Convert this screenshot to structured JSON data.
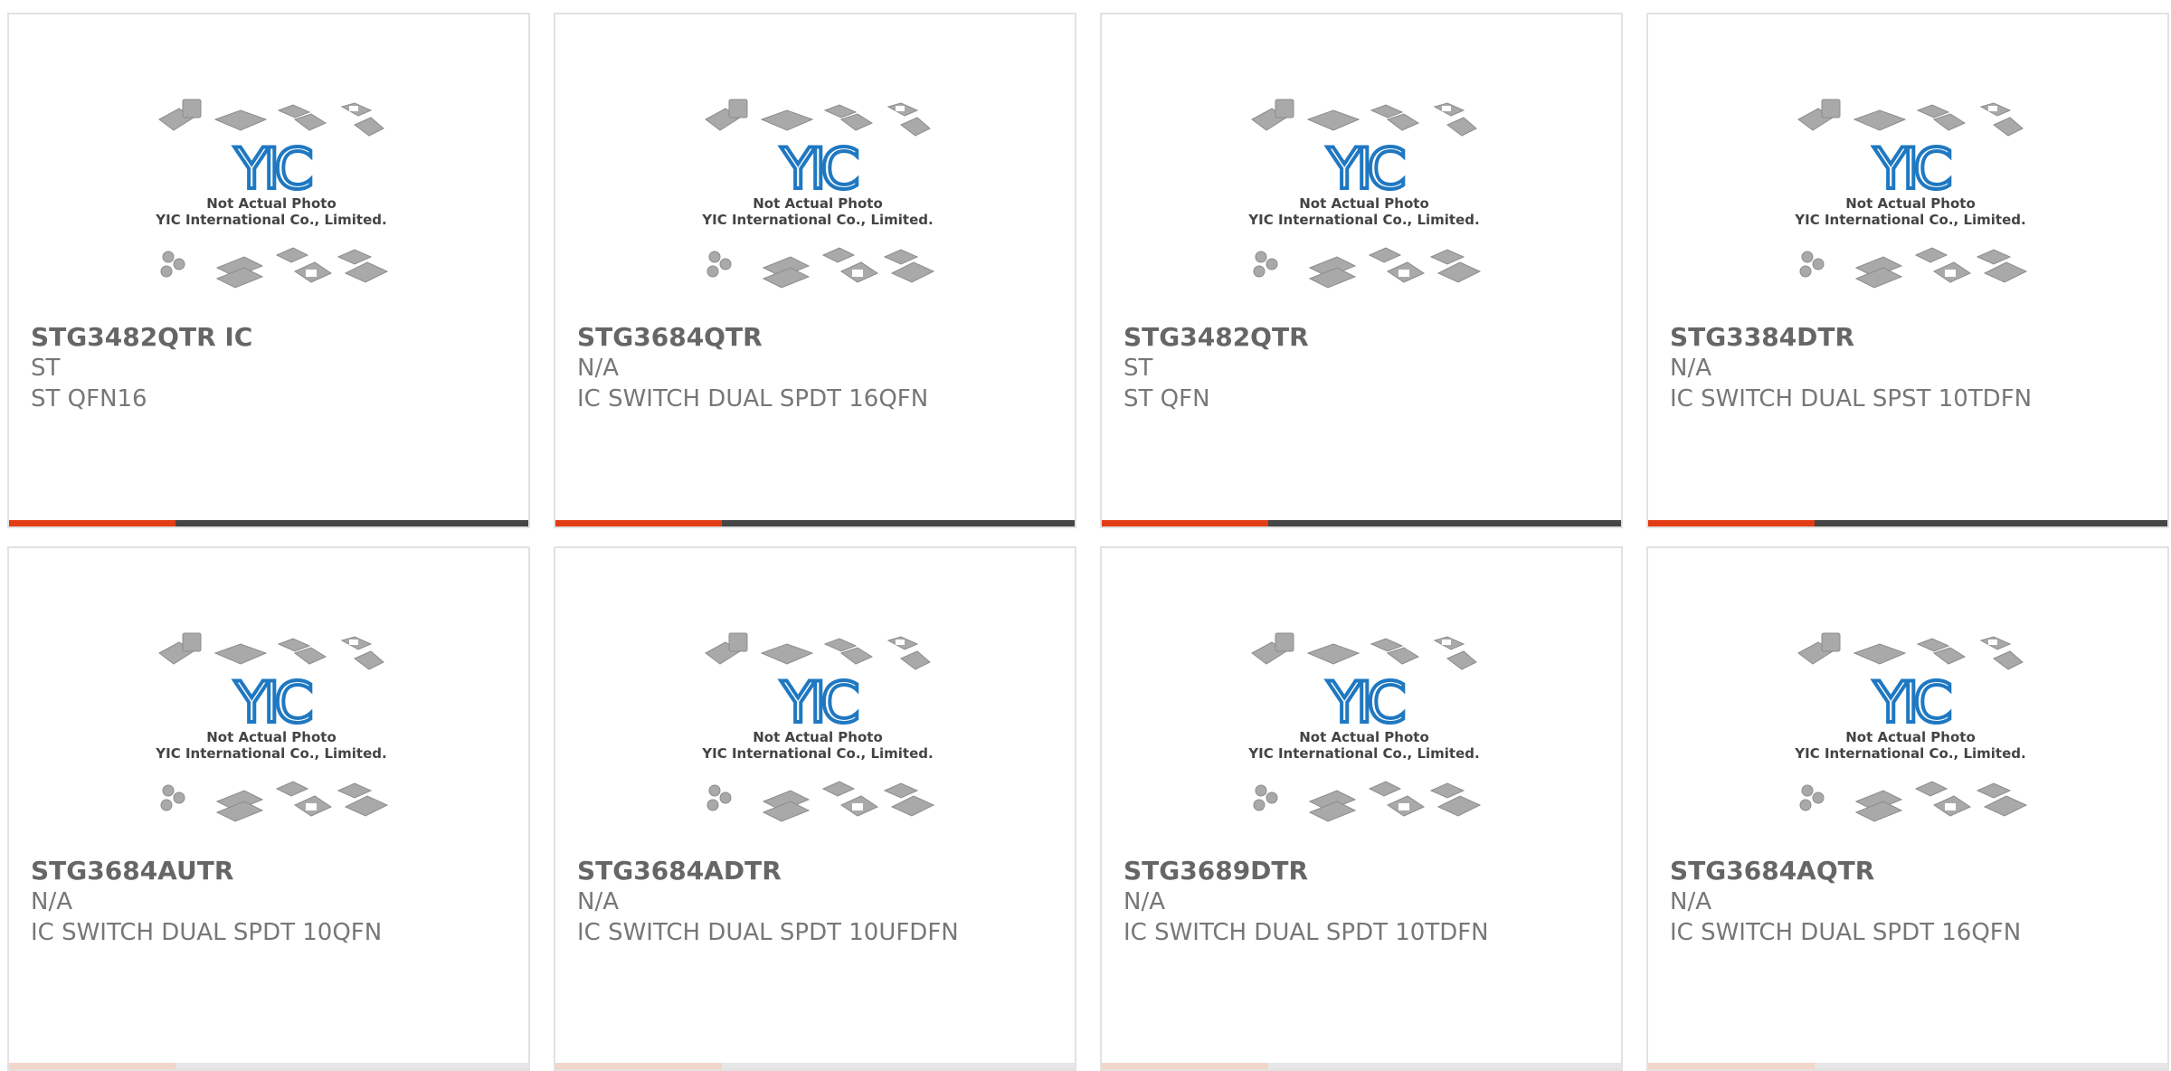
{
  "image": {
    "line1": "Not Actual Photo",
    "line2": "YIC International Co., Limited.",
    "logo_text": "YIC"
  },
  "colors": {
    "accent": "#e23c14",
    "bar_dark": "#454545",
    "logo_blue": "#1f78c1"
  },
  "products": [
    {
      "title": "STG3482QTR IC",
      "manufacturer": "ST",
      "description": "ST QFN16"
    },
    {
      "title": "STG3684QTR",
      "manufacturer": "N/A",
      "description": "IC SWITCH DUAL SPDT 16QFN"
    },
    {
      "title": "STG3482QTR",
      "manufacturer": "ST",
      "description": "ST QFN"
    },
    {
      "title": "STG3384DTR",
      "manufacturer": "N/A",
      "description": "IC SWITCH DUAL SPST 10TDFN"
    },
    {
      "title": "STG3684AUTR",
      "manufacturer": "N/A",
      "description": "IC SWITCH DUAL SPDT 10QFN"
    },
    {
      "title": "STG3684ADTR",
      "manufacturer": "N/A",
      "description": "IC SWITCH DUAL SPDT 10UFDFN"
    },
    {
      "title": "STG3689DTR",
      "manufacturer": "N/A",
      "description": "IC SWITCH DUAL SPDT 10TDFN"
    },
    {
      "title": "STG3684AQTR",
      "manufacturer": "N/A",
      "description": "IC SWITCH DUAL SPDT 16QFN"
    }
  ]
}
